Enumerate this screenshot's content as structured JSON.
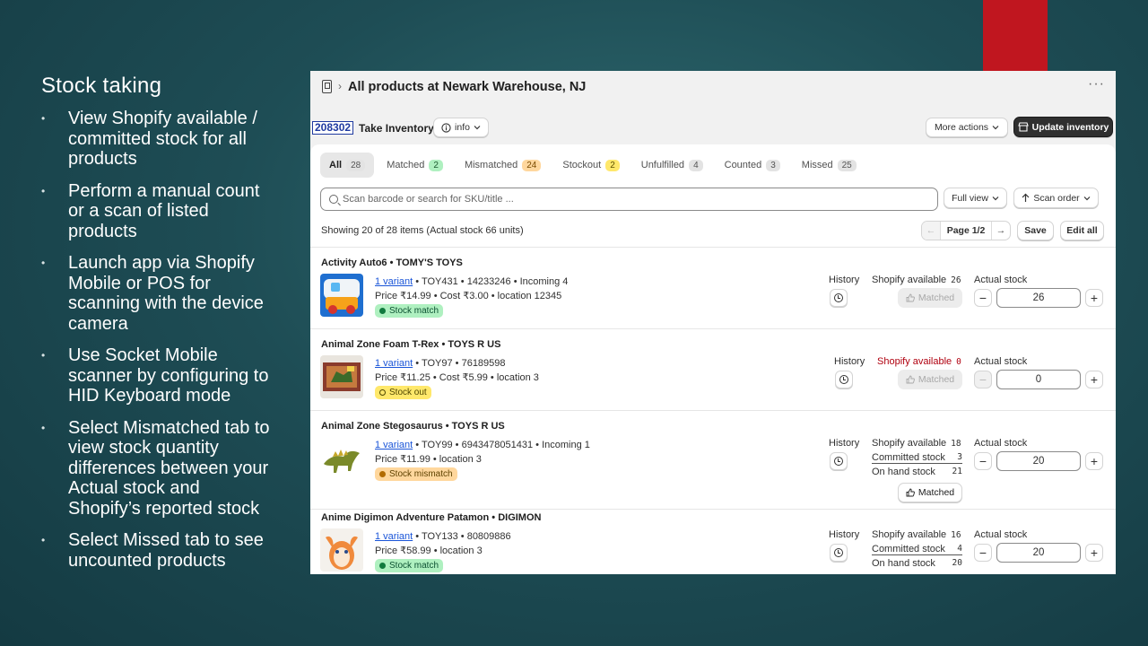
{
  "slide": {
    "title": "Stock taking",
    "bullets": [
      "View Shopify available / committed stock for all products",
      "Perform a manual count or a scan of listed products",
      "Launch app via Shopify Mobile or POS for scanning with the device camera",
      "Use Socket Mobile scanner by configuring to HID Keyboard mode",
      "Select Mismatched tab to view stock quantity differences between your Actual stock and Shopify’s reported stock",
      "Select Missed tab to see uncounted products"
    ],
    "bullet_glyph": "•"
  },
  "header": {
    "separator": "›",
    "title": "All products at Newark Warehouse, NJ",
    "more_glyph": "···"
  },
  "toolbar": {
    "inventory_id": "208302",
    "take_inventory": "Take Inventory",
    "info_label": "info",
    "more_actions": "More actions",
    "update_inventory": "Update inventory"
  },
  "tabs": [
    {
      "label": "All",
      "count": "28"
    },
    {
      "label": "Matched",
      "count": "2"
    },
    {
      "label": "Mismatched",
      "count": "24"
    },
    {
      "label": "Stockout",
      "count": "2"
    },
    {
      "label": "Unfulfilled",
      "count": "4"
    },
    {
      "label": "Counted",
      "count": "3"
    },
    {
      "label": "Missed",
      "count": "25"
    }
  ],
  "search": {
    "placeholder": "Scan barcode or search for SKU/title ...",
    "full_view": "Full view",
    "scan_order": "Scan order"
  },
  "listing": {
    "showing": "Showing 20 of 28 items (Actual stock 66 units)",
    "page": "Page 1/2",
    "save": "Save",
    "edit_all": "Edit all",
    "prev_glyph": "←",
    "next_glyph": "→"
  },
  "labels": {
    "history": "History",
    "shopify_available": "Shopify available",
    "committed_stock": "Committed stock",
    "on_hand_stock": "On hand stock",
    "actual_stock": "Actual stock",
    "matched": "Matched",
    "minus": "−",
    "plus": "+"
  },
  "products": [
    {
      "name": "Activity Auto6 • TOMY'S TOYS",
      "variant": "1 variant",
      "line1_rest": " • TOY431 • 14233246 • Incoming 4",
      "line2": "Price ₹14.99 • Cost ₹3.00 • location 12345",
      "status": "Stock match",
      "shopify_available": "26",
      "actual_stock": "26"
    },
    {
      "name": "Animal Zone Foam T-Rex • TOYS R US",
      "variant": "1 variant",
      "line1_rest": " • TOY97 • 76189598",
      "line2": "Price ₹11.25 • Cost ₹5.99 • location 3",
      "status": "Stock out",
      "shopify_available": "0",
      "actual_stock": "0"
    },
    {
      "name": "Animal Zone Stegosaurus • TOYS R US",
      "variant": "1 variant",
      "line1_rest": " • TOY99 • 6943478051431 • Incoming 1",
      "line2": "Price ₹11.99 • location 3",
      "status": "Stock mismatch",
      "shopify_available": "18",
      "committed_stock": "3",
      "on_hand_stock": "21",
      "actual_stock": "20"
    },
    {
      "name": "Anime Digimon Adventure Patamon • DIGIMON",
      "variant": "1 variant",
      "line1_rest": " • TOY133 • 80809886",
      "line2": "Price ₹58.99 • location 3",
      "status": "Stock match",
      "shopify_available": "16",
      "committed_stock": "4",
      "on_hand_stock": "20",
      "actual_stock": "20"
    }
  ],
  "colors": {
    "slide_bg": "#1e4d55",
    "accent_red": "#c0161f",
    "link_blue": "#1a55d8",
    "alert_red": "#b0000f",
    "badge_green": "#aff0c0",
    "badge_orange": "#ffd79d",
    "badge_yellow": "#ffe86b"
  },
  "icons": [
    "pos-device-icon",
    "info-icon",
    "store-icon",
    "search-icon",
    "upload-arrow-icon",
    "clock-icon",
    "thumbs-up-icon"
  ]
}
